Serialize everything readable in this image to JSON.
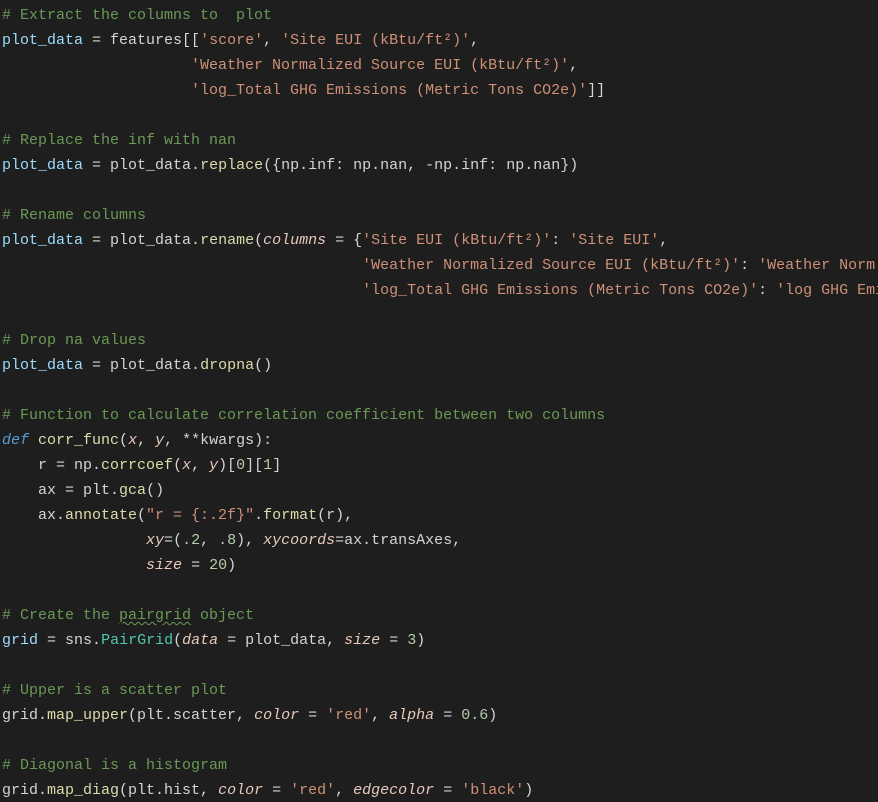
{
  "lines": [
    [
      [
        "cm",
        "# Extract the columns to  plot"
      ]
    ],
    [
      [
        "va",
        "plot_data"
      ],
      [
        "op",
        " "
      ],
      [
        "op",
        "="
      ],
      [
        "op",
        " features[["
      ],
      [
        "st",
        "'score'"
      ],
      [
        "op",
        ", "
      ],
      [
        "st",
        "'Site EUI (kBtu/ft²)'"
      ],
      [
        "op",
        ","
      ]
    ],
    [
      [
        "op",
        "                     "
      ],
      [
        "st",
        "'Weather Normalized Source EUI (kBtu/ft²)'"
      ],
      [
        "op",
        ", "
      ]
    ],
    [
      [
        "op",
        "                     "
      ],
      [
        "st",
        "'log_Total GHG Emissions (Metric Tons CO2e)'"
      ],
      [
        "op",
        "]]"
      ]
    ],
    [],
    [
      [
        "cm",
        "# Replace the inf with nan"
      ]
    ],
    [
      [
        "va",
        "plot_data"
      ],
      [
        "op",
        " "
      ],
      [
        "op",
        "="
      ],
      [
        "op",
        " plot_data."
      ],
      [
        "fn",
        "replace"
      ],
      [
        "op",
        "({np.inf"
      ],
      [
        "op",
        ":"
      ],
      [
        "op",
        " np.nan, "
      ],
      [
        "op",
        "-"
      ],
      [
        "op",
        "np.inf"
      ],
      [
        "op",
        ":"
      ],
      [
        "op",
        " np.nan})"
      ]
    ],
    [],
    [
      [
        "cm",
        "# Rename columns"
      ]
    ],
    [
      [
        "va",
        "plot_data"
      ],
      [
        "op",
        " "
      ],
      [
        "op",
        "="
      ],
      [
        "op",
        " plot_data."
      ],
      [
        "fn",
        "rename"
      ],
      [
        "op",
        "("
      ],
      [
        "pa",
        "columns"
      ],
      [
        "op",
        " "
      ],
      [
        "op",
        "="
      ],
      [
        "op",
        " {"
      ],
      [
        "st",
        "'Site EUI (kBtu/ft²)'"
      ],
      [
        "op",
        ": "
      ],
      [
        "st",
        "'Site EUI'"
      ],
      [
        "op",
        ", "
      ]
    ],
    [
      [
        "op",
        "                                        "
      ],
      [
        "st",
        "'Weather Normalized Source EUI (kBtu/ft²)'"
      ],
      [
        "op",
        ": "
      ],
      [
        "st",
        "'Weather Norm EUI'"
      ],
      [
        "op",
        ","
      ]
    ],
    [
      [
        "op",
        "                                        "
      ],
      [
        "st",
        "'log_Total GHG Emissions (Metric Tons CO2e)'"
      ],
      [
        "op",
        ": "
      ],
      [
        "st",
        "'log GHG Emissions'"
      ],
      [
        "op",
        "})"
      ]
    ],
    [],
    [
      [
        "cm",
        "# Drop na values"
      ]
    ],
    [
      [
        "va",
        "plot_data"
      ],
      [
        "op",
        " "
      ],
      [
        "op",
        "="
      ],
      [
        "op",
        " plot_data."
      ],
      [
        "fn",
        "dropna"
      ],
      [
        "op",
        "()"
      ]
    ],
    [],
    [
      [
        "cm",
        "# Function to calculate correlation coefficient between two columns"
      ]
    ],
    [
      [
        "kw",
        "def"
      ],
      [
        "op",
        " "
      ],
      [
        "fn",
        "corr_func"
      ],
      [
        "op",
        "("
      ],
      [
        "pa",
        "x"
      ],
      [
        "op",
        ", "
      ],
      [
        "pa",
        "y"
      ],
      [
        "op",
        ", "
      ],
      [
        "op",
        "**kwargs)"
      ],
      [
        "op",
        ":"
      ]
    ],
    [
      [
        "op",
        "    r "
      ],
      [
        "op",
        "="
      ],
      [
        "op",
        " np."
      ],
      [
        "fn",
        "corrcoef"
      ],
      [
        "op",
        "("
      ],
      [
        "pa",
        "x"
      ],
      [
        "op",
        ", "
      ],
      [
        "pa",
        "y"
      ],
      [
        "op",
        ")["
      ],
      [
        "nu",
        "0"
      ],
      [
        "op",
        "]["
      ],
      [
        "nu",
        "1"
      ],
      [
        "op",
        "]"
      ]
    ],
    [
      [
        "op",
        "    ax "
      ],
      [
        "op",
        "="
      ],
      [
        "op",
        " plt."
      ],
      [
        "fn",
        "gca"
      ],
      [
        "op",
        "()"
      ]
    ],
    [
      [
        "op",
        "    ax."
      ],
      [
        "fn",
        "annotate"
      ],
      [
        "op",
        "("
      ],
      [
        "st",
        "\"r = {:.2f}\""
      ],
      [
        "op",
        "."
      ],
      [
        "fn",
        "format"
      ],
      [
        "op",
        "(r),"
      ]
    ],
    [
      [
        "op",
        "                "
      ],
      [
        "pa",
        "xy"
      ],
      [
        "op",
        "="
      ],
      [
        "op",
        "("
      ],
      [
        "nu",
        ".2"
      ],
      [
        "op",
        ", "
      ],
      [
        "nu",
        ".8"
      ],
      [
        "op",
        "), "
      ],
      [
        "pa",
        "xycoords"
      ],
      [
        "op",
        "="
      ],
      [
        "op",
        "ax.transAxes,"
      ]
    ],
    [
      [
        "op",
        "                "
      ],
      [
        "pa",
        "size"
      ],
      [
        "op",
        " "
      ],
      [
        "op",
        "="
      ],
      [
        "op",
        " "
      ],
      [
        "nu",
        "20"
      ],
      [
        "op",
        ")"
      ]
    ],
    [
      [
        "op",
        "    "
      ]
    ],
    [
      [
        "cm",
        "# Create the "
      ],
      [
        "cm wavy",
        "pairgrid"
      ],
      [
        "cm",
        " object"
      ]
    ],
    [
      [
        "va",
        "grid"
      ],
      [
        "op",
        " "
      ],
      [
        "op",
        "="
      ],
      [
        "op",
        " sns."
      ],
      [
        "cl",
        "PairGrid"
      ],
      [
        "op",
        "("
      ],
      [
        "pa",
        "data"
      ],
      [
        "op",
        " "
      ],
      [
        "op",
        "="
      ],
      [
        "op",
        " plot_data, "
      ],
      [
        "pa",
        "size"
      ],
      [
        "op",
        " "
      ],
      [
        "op",
        "="
      ],
      [
        "op",
        " "
      ],
      [
        "nu",
        "3"
      ],
      [
        "op",
        ")"
      ]
    ],
    [],
    [
      [
        "cm",
        "# Upper is a scatter plot"
      ]
    ],
    [
      [
        "op",
        "grid."
      ],
      [
        "fn",
        "map_upper"
      ],
      [
        "op",
        "(plt.scatter, "
      ],
      [
        "pa",
        "color"
      ],
      [
        "op",
        " "
      ],
      [
        "op",
        "="
      ],
      [
        "op",
        " "
      ],
      [
        "st",
        "'red'"
      ],
      [
        "op",
        ", "
      ],
      [
        "pa",
        "alpha"
      ],
      [
        "op",
        " "
      ],
      [
        "op",
        "="
      ],
      [
        "op",
        " "
      ],
      [
        "nu",
        "0.6"
      ],
      [
        "op",
        ")"
      ]
    ],
    [],
    [
      [
        "cm",
        "# Diagonal is a histogram"
      ]
    ],
    [
      [
        "op",
        "grid."
      ],
      [
        "fn",
        "map_diag"
      ],
      [
        "op",
        "(plt.hist, "
      ],
      [
        "pa",
        "color"
      ],
      [
        "op",
        " "
      ],
      [
        "op",
        "="
      ],
      [
        "op",
        " "
      ],
      [
        "st",
        "'red'"
      ],
      [
        "op",
        ", "
      ],
      [
        "pa",
        "edgecolor"
      ],
      [
        "op",
        " "
      ],
      [
        "op",
        "="
      ],
      [
        "op",
        " "
      ],
      [
        "st",
        "'black'"
      ],
      [
        "op",
        ")"
      ]
    ]
  ]
}
